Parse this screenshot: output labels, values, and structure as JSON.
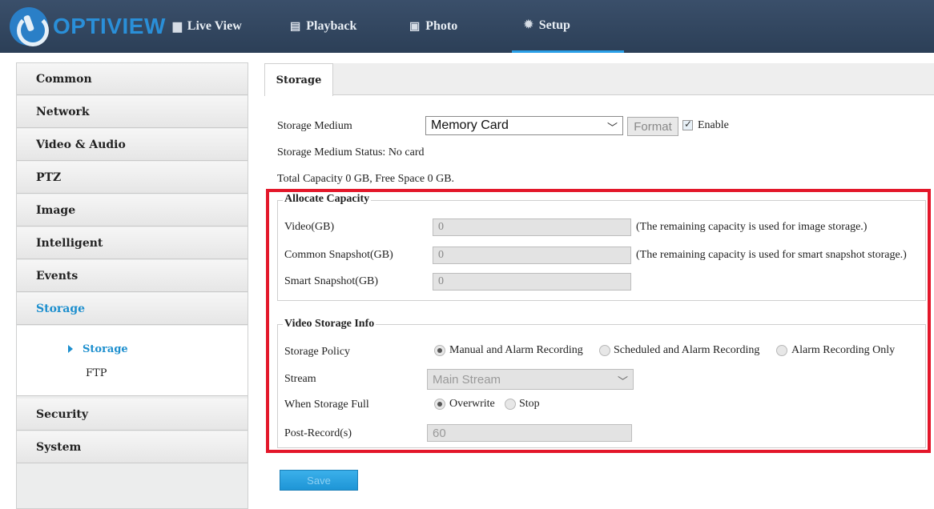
{
  "header": {
    "logo_text": "OPTIVIEW",
    "nav": [
      {
        "label": "Live View",
        "icon": "monitor-icon"
      },
      {
        "label": "Playback",
        "icon": "film-icon"
      },
      {
        "label": "Photo",
        "icon": "image-icon"
      },
      {
        "label": "Setup",
        "icon": "gear-icon"
      }
    ],
    "active_nav": "Setup"
  },
  "sidebar": {
    "items": [
      "Common",
      "Network",
      "Video & Audio",
      "PTZ",
      "Image",
      "Intelligent",
      "Events",
      "Storage",
      "Security",
      "System"
    ],
    "active": "Storage",
    "sub_items": [
      "Storage",
      "FTP"
    ],
    "active_sub": "Storage"
  },
  "tab": {
    "label": "Storage"
  },
  "storage": {
    "medium_label": "Storage Medium",
    "medium_value": "Memory Card",
    "format_label": "Format",
    "enable_label": "Enable",
    "status_text": "Storage Medium Status:  No card",
    "capacity_text": "Total Capacity  0  GB,  Free Space  0  GB."
  },
  "allocate": {
    "legend": "Allocate Capacity",
    "video_label": "Video(GB)",
    "video_value": "0",
    "video_note": "(The remaining capacity is used for image storage.)",
    "common_label": "Common Snapshot(GB)",
    "common_value": "0",
    "common_note": "(The remaining capacity is used for smart snapshot storage.)",
    "smart_label": "Smart Snapshot(GB)",
    "smart_value": "0"
  },
  "video_info": {
    "legend": "Video Storage Info",
    "policy_label": "Storage Policy",
    "policy_options": [
      "Manual and Alarm Recording",
      "Scheduled and Alarm Recording",
      "Alarm Recording Only"
    ],
    "policy_selected": "Manual and Alarm Recording",
    "stream_label": "Stream",
    "stream_value": "Main Stream",
    "full_label": "When Storage Full",
    "full_options": [
      "Overwrite",
      "Stop"
    ],
    "full_selected": "Overwrite",
    "post_label": "Post-Record(s)",
    "post_value": "60"
  },
  "save_label": "Save",
  "colors": {
    "accent": "#1d8fce",
    "highlight": "#e3172a",
    "topbar": "#34495f"
  }
}
